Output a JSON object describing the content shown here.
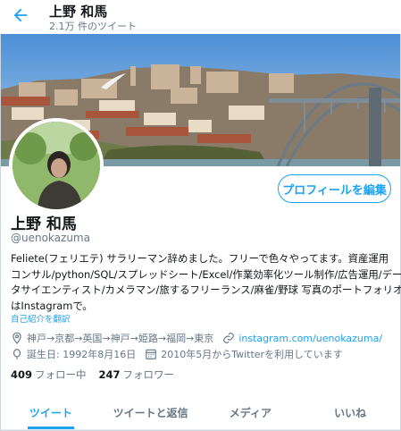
{
  "header": {
    "name": "上野 和馬",
    "tweet_count": "2.1万 件のツイート"
  },
  "profile": {
    "edit_button": "プロフィールを編集",
    "name": "上野 和馬",
    "handle": "@uenokazuma",
    "bio_lines": [
      "Feliete(フェリエテ) サラリーマン辞めました。フリーで色々やってます。資産運用",
      "コンサル/python/SQL/スプレッドシート/Excel/作業効率化ツール制作/広告運用/デー",
      "タサイエンティスト/カメラマン/旅するフリーランス/麻雀/野球 写真のポートフォリオ",
      "はInstagramで。"
    ],
    "translate_link": "自己紹介を翻訳",
    "location": "神戸→京都→英国→神戸→姫路→福岡→東京",
    "website": "instagram.com/uenokazuma/",
    "birthday": "誕生日: 1992年8月16日",
    "joined": "2010年5月からTwitterを利用しています",
    "following_count": "409",
    "following_label": "フォロー中",
    "followers_count": "247",
    "followers_label": "フォロワー"
  },
  "tabs": [
    {
      "label": "ツイート",
      "active": true
    },
    {
      "label": "ツイートと返信",
      "active": false
    },
    {
      "label": "メディア",
      "active": false
    },
    {
      "label": "いいね",
      "active": false
    }
  ],
  "colors": {
    "accent": "#1da1f2",
    "secondary_text": "#657786"
  },
  "icons": [
    "back-arrow-icon",
    "location-icon",
    "link-icon",
    "birthday-icon",
    "calendar-icon"
  ]
}
